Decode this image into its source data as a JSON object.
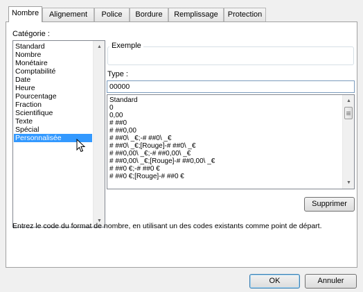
{
  "tabs": [
    {
      "label": "Nombre",
      "active": true
    },
    {
      "label": "Alignement",
      "active": false
    },
    {
      "label": "Police",
      "active": false
    },
    {
      "label": "Bordure",
      "active": false
    },
    {
      "label": "Remplissage",
      "active": false
    },
    {
      "label": "Protection",
      "active": false
    }
  ],
  "category": {
    "label": "Catégorie :",
    "items": [
      "Standard",
      "Nombre",
      "Monétaire",
      "Comptabilité",
      "Date",
      "Heure",
      "Pourcentage",
      "Fraction",
      "Scientifique",
      "Texte",
      "Spécial",
      "Personnalisée"
    ],
    "selected": "Personnalisée"
  },
  "sample": {
    "label": "Exemple",
    "value": ""
  },
  "type": {
    "label": "Type :",
    "value": "00000",
    "formats": [
      "Standard",
      "0",
      "0,00",
      "# ##0",
      "# ##0,00",
      "# ##0\\ _€;-# ##0\\ _€",
      "# ##0\\ _€;[Rouge]-# ##0\\ _€",
      "# ##0,00\\ _€;-# ##0,00\\ _€",
      "# ##0,00\\ _€;[Rouge]-# ##0,00\\ _€",
      "# ##0 €;-# ##0 €",
      "# ##0 €;[Rouge]-# ##0 €"
    ]
  },
  "buttons": {
    "delete": "Supprimer",
    "ok": "OK",
    "cancel": "Annuler"
  },
  "help_text": "Entrez le code du format de nombre, en utilisant un des codes existants comme point de départ.",
  "colors": {
    "selection": "#3399ff",
    "panel_border": "#a0a0a0"
  }
}
